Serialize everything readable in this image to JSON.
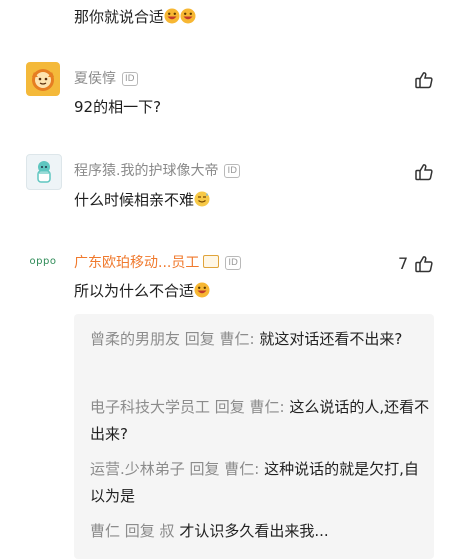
{
  "top_comment": {
    "text": "那你就说合适",
    "emoji": "grin-emoji-pair"
  },
  "comments": [
    {
      "user": "夏侯惇",
      "id_badge": "ID",
      "text": "92的相一下?",
      "avatar_icon": "orange-cat-avatar-icon",
      "likes": ""
    },
    {
      "user": "程序猿.我的护球像大帝",
      "id_badge": "ID",
      "text": "什么时候相亲不难",
      "avatar_icon": "green-figure-avatar-icon",
      "likes": ""
    },
    {
      "user": "广东欧珀移动...员工",
      "id_badge": "ID",
      "text": "所以为什么不合适",
      "avatar_icon": "oppo-logo-icon",
      "logo_text": "oppo",
      "likes": "7"
    }
  ],
  "replies": [
    {
      "who": "曾柔的男朋友 回复 曹仁:",
      "text": "就这对话还看不出来?"
    },
    {
      "who": "电子科技大学员工 回复 曹仁:",
      "text": "这么说话的人,还看不出来?"
    },
    {
      "who": "运营.少林弟子 回复 曹仁:",
      "text": "这种说话的就是欠打,自以为是"
    },
    {
      "who": "曹仁 回复 叔",
      "text": "才认识多久看出来我..."
    }
  ],
  "colors": {
    "username_orange": "#f07a2e",
    "username_gray": "#8a8a8a",
    "reply_bg": "#f5f5f5"
  }
}
